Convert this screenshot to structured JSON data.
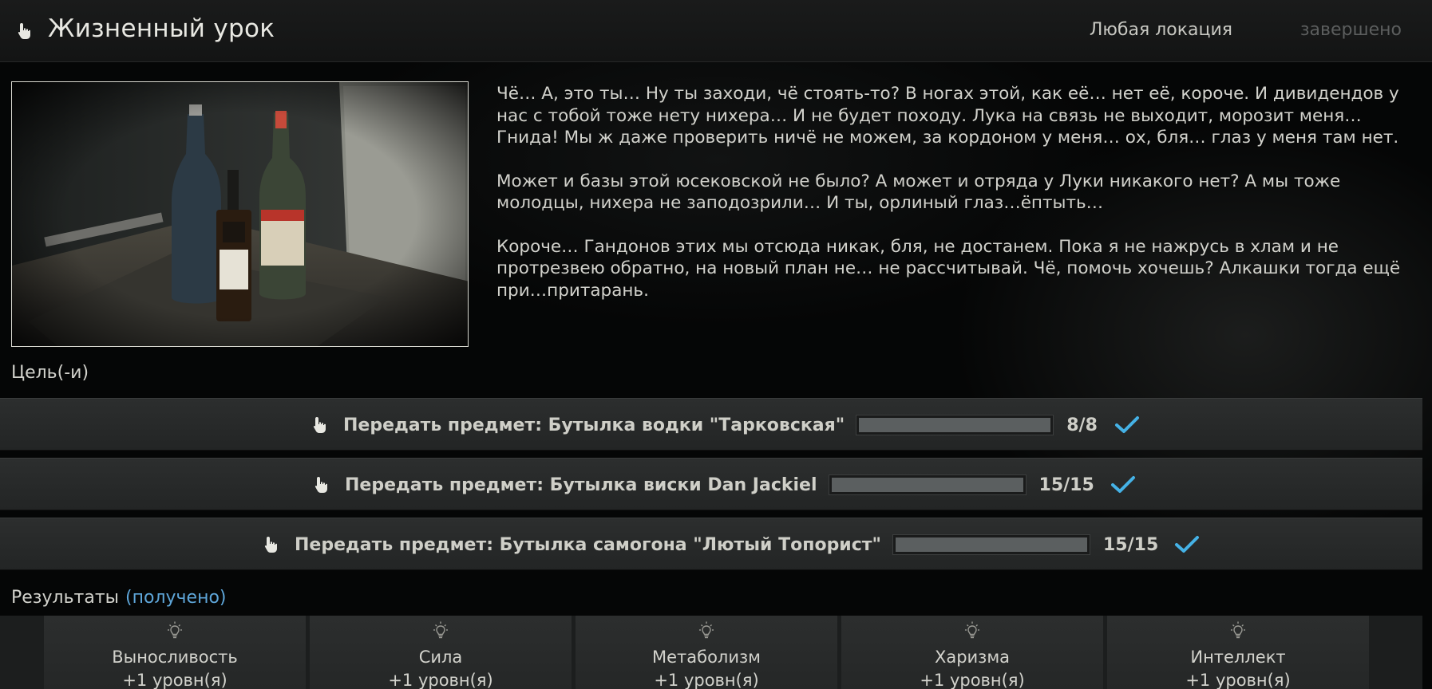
{
  "header": {
    "title": "Жизненный урок",
    "location": "Любая локация",
    "status": "завершено"
  },
  "description": [
    "Чё… А, это ты… Ну ты заходи, чё стоять-то? В ногах этой, как её… нет её, короче. И дивидендов у нас с тобой тоже нету нихера… И не будет походу. Лука на связь не выходит, морозит меня… Гнида! Мы ж даже проверить ничё не можем, за кордоном у меня… ох, бля… глаз у меня там нет.",
    "Может и базы этой юсековской не было? А может и отряда у Луки никакого нет? А мы тоже молодцы, нихера не заподозрили… И ты, орлиный глаз…ёптыть…",
    "Короче… Гандонов этих мы отсюда никак, бля, не достанем. Пока я не нажрусь в хлам и не протрезвею обратно, на новый план не… не рассчитывай. Чё, помочь хочешь? Алкашки тогда ещё при…притарань."
  ],
  "goals_label": "Цель(-и)",
  "objectives": [
    {
      "text": "Передать предмет: Бутылка водки \"Тарковская\"",
      "count": "8/8",
      "progress": 1.0
    },
    {
      "text": "Передать предмет: Бутылка виски Dan Jackiel",
      "count": "15/15",
      "progress": 1.0
    },
    {
      "text": "Передать предмет: Бутылка самогона \"Лютый Топорист\"",
      "count": "15/15",
      "progress": 1.0
    }
  ],
  "results": {
    "label": "Результаты",
    "received": "(получено)"
  },
  "rewards": [
    {
      "icon": "lightbulb-icon",
      "name": "Выносливость",
      "level": "+1 уровн(я)"
    },
    {
      "icon": "lightbulb-icon",
      "name": "Сила",
      "level": "+1 уровн(я)"
    },
    {
      "icon": "lightbulb-icon",
      "name": "Метаболизм",
      "level": "+1 уровн(я)"
    },
    {
      "icon": "lightbulb-icon",
      "name": "Харизма",
      "level": "+1 уровн(я)"
    },
    {
      "icon": "lightbulb-icon",
      "name": "Интеллект",
      "level": "+1 уровн(я)"
    }
  ],
  "colors": {
    "accent_check": "#45b2e6",
    "received_text": "#5ea6d9",
    "status_dim": "#5c5e5e"
  }
}
